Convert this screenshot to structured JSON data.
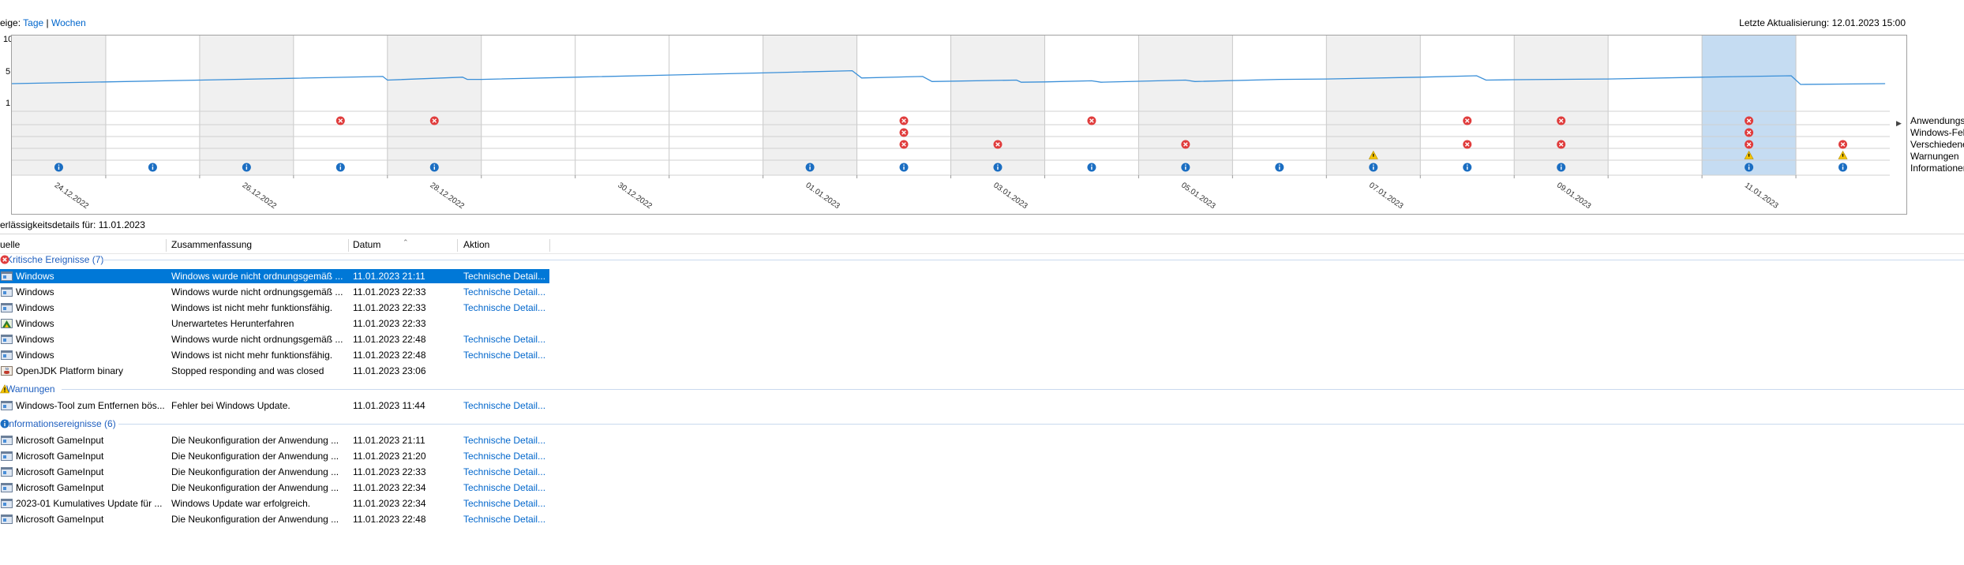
{
  "header": {
    "view_label": "eige:",
    "view_days": "Tage",
    "view_separator": "|",
    "view_weeks": "Wochen",
    "last_update": "Letzte Aktualisierung: 12.01.2023 15:00"
  },
  "chart_data": {
    "type": "line",
    "y_tick_labels": [
      "10",
      "5",
      "1"
    ],
    "ylim": [
      1,
      10
    ],
    "columns": 20,
    "x_tick_labels": [
      "24.12.2022",
      "26.12.2022",
      "28.12.2022",
      "30.12.2022",
      "01.01.2023",
      "03.01.2023",
      "05.01.2023",
      "07.01.2023",
      "09.01.2023",
      "11.01.2023"
    ],
    "selected_column": 18,
    "series": [
      {
        "color": "#3a8fd8",
        "x": [
          0,
          1,
          2,
          3,
          3.95,
          4.0,
          4.8,
          4.85,
          5,
          6,
          7,
          8,
          8.95,
          9.05,
          9.7,
          9.8,
          10.7,
          10.75,
          11,
          11.5,
          11.6,
          12.5,
          12.6,
          13.5,
          14,
          15,
          15.6,
          15.7,
          16,
          17,
          18,
          18.95,
          19.05,
          19.5,
          19.95
        ],
        "y": [
          3.3,
          3.55,
          3.8,
          4.05,
          4.3,
          3.8,
          4.2,
          3.9,
          3.9,
          4.2,
          4.5,
          4.8,
          5.1,
          4.1,
          4.3,
          3.6,
          3.8,
          3.5,
          3.55,
          3.7,
          3.5,
          3.8,
          3.6,
          3.9,
          3.95,
          4.2,
          4.4,
          3.8,
          3.85,
          3.95,
          4.2,
          4.4,
          3.2,
          3.25,
          3.3
        ]
      }
    ],
    "row_labels": [
      "Anwendungsf",
      "Windows-Feh",
      "Verschiedene",
      "Warnungen",
      "Informationer"
    ],
    "events": {
      "app_errors": [
        3,
        4,
        9,
        11,
        15,
        16,
        18
      ],
      "windows_errors": [
        9,
        18
      ],
      "misc_errors": [
        9,
        10,
        12,
        15,
        16,
        18,
        19
      ],
      "warnings": [
        14,
        18,
        19
      ],
      "info": [
        0,
        1,
        2,
        3,
        4,
        8,
        9,
        10,
        11,
        12,
        13,
        14,
        15,
        16,
        18,
        19
      ]
    }
  },
  "details": {
    "title": "erlässigkeitsdetails für: 11.01.2023",
    "columns": [
      "uelle",
      "Zusammenfassung",
      "Datum",
      "Aktion"
    ]
  },
  "groups": {
    "critical": "Kritische Ereignisse (7)",
    "warnings": "Warnungen",
    "info": "Informationsereignisse (6)"
  },
  "rows": [
    {
      "source": "Windows",
      "summary": "Windows wurde nicht ordnungsgemäß ...",
      "date": "11.01.2023 21:11",
      "action": "Technische Detail...",
      "icon": "window-icon"
    },
    {
      "source": "Windows",
      "summary": "Windows wurde nicht ordnungsgemäß ...",
      "date": "11.01.2023 22:33",
      "action": "Technische Detail...",
      "icon": "window-icon"
    },
    {
      "source": "Windows",
      "summary": "Windows ist nicht mehr funktionsfähig.",
      "date": "11.01.2023 22:33",
      "action": "Technische Detail...",
      "icon": "window-icon"
    },
    {
      "source": "Windows",
      "summary": "Unerwartetes Herunterfahren",
      "date": "11.01.2023 22:33",
      "action": "",
      "icon": "shutdown-icon"
    },
    {
      "source": "Windows",
      "summary": "Windows wurde nicht ordnungsgemäß ...",
      "date": "11.01.2023 22:48",
      "action": "Technische Detail...",
      "icon": "window-icon"
    },
    {
      "source": "Windows",
      "summary": "Windows ist nicht mehr funktionsfähig.",
      "date": "11.01.2023 22:48",
      "action": "Technische Detail...",
      "icon": "window-icon"
    },
    {
      "source": "OpenJDK Platform binary",
      "summary": "Stopped responding and was closed",
      "date": "11.01.2023 23:06",
      "action": "",
      "icon": "java-icon"
    },
    {
      "source": "Windows-Tool zum Entfernen bös...",
      "summary": "Fehler bei Windows Update.",
      "date": "11.01.2023 11:44",
      "action": "Technische Detail...",
      "icon": "window-icon"
    },
    {
      "source": "Microsoft GameInput",
      "summary": "Die Neukonfiguration der Anwendung ...",
      "date": "11.01.2023 21:11",
      "action": "Technische Detail...",
      "icon": "window-icon"
    },
    {
      "source": "Microsoft GameInput",
      "summary": "Die Neukonfiguration der Anwendung ...",
      "date": "11.01.2023 21:20",
      "action": "Technische Detail...",
      "icon": "window-icon"
    },
    {
      "source": "Microsoft GameInput",
      "summary": "Die Neukonfiguration der Anwendung ...",
      "date": "11.01.2023 22:33",
      "action": "Technische Detail...",
      "icon": "window-icon"
    },
    {
      "source": "Microsoft GameInput",
      "summary": "Die Neukonfiguration der Anwendung ...",
      "date": "11.01.2023 22:34",
      "action": "Technische Detail...",
      "icon": "window-icon"
    },
    {
      "source": "2023-01 Kumulatives Update für ...",
      "summary": "Windows Update war erfolgreich.",
      "date": "11.01.2023 22:34",
      "action": "Technische Detail...",
      "icon": "window-icon"
    },
    {
      "source": "Microsoft GameInput",
      "summary": "Die Neukonfiguration der Anwendung ...",
      "date": "11.01.2023 22:48",
      "action": "Technische Detail...",
      "icon": "window-icon"
    }
  ],
  "colors": {
    "accent": "#0078d7",
    "link": "#0066cc",
    "error": "#e03c3c",
    "warning": "#f5c400",
    "info": "#1b6ec2",
    "line": "#3a8fd8"
  }
}
